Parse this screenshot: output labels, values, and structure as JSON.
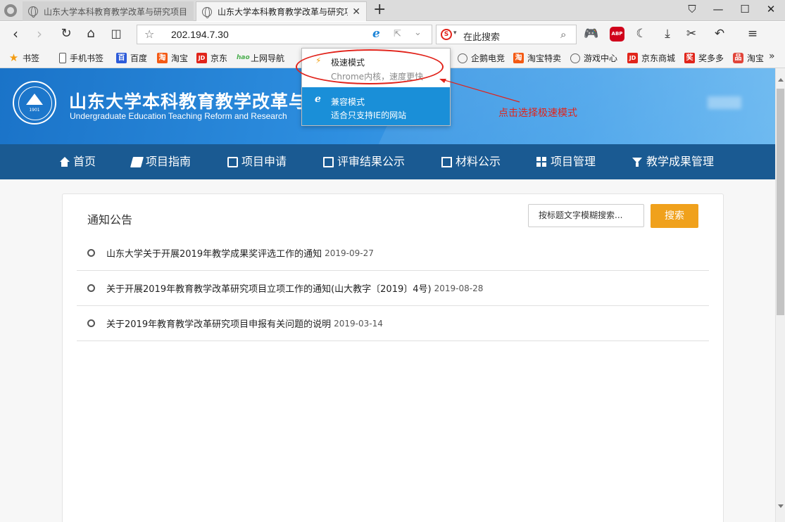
{
  "browser": {
    "tabs": [
      {
        "title": "山东大学本科教育教学改革与研究项目",
        "active": false
      },
      {
        "title": "山东大学本科教育教学改革与研究项",
        "active": true
      }
    ],
    "address": "202.194.7.30",
    "search_placeholder": "在此搜索",
    "bookmarks": [
      {
        "label": "书签",
        "icon": "star-icon"
      },
      {
        "label": "手机书签",
        "icon": "phone-icon"
      },
      {
        "label": "百度",
        "icon": "baidu-icon"
      },
      {
        "label": "淘宝",
        "icon": "taobao-icon"
      },
      {
        "label": "京东",
        "icon": "jd-icon"
      },
      {
        "label": "上网导航",
        "icon": "hao-icon"
      },
      {
        "label": "企鹅电竞",
        "icon": "globe-icon"
      },
      {
        "label": "淘宝特卖",
        "icon": "taobao-icon"
      },
      {
        "label": "游戏中心",
        "icon": "globe-icon"
      },
      {
        "label": "京东商城",
        "icon": "jd-icon"
      },
      {
        "label": "奖多多",
        "icon": "jiang-icon"
      },
      {
        "label": "淘宝",
        "icon": "ping-icon"
      }
    ],
    "icon_glyphs": {
      "jd": "JD",
      "taobao": "淘",
      "baidu": "百",
      "jiang": "奖",
      "ping": "品",
      "hao": "hao",
      "sogou": "S",
      "abp": "ABP"
    }
  },
  "mode_popup": {
    "fast": {
      "title": "极速模式",
      "desc": "Chrome内核，速度更快"
    },
    "compat": {
      "title": "兼容模式",
      "desc": "适合只支持IE的网站"
    }
  },
  "annotation": {
    "text": "点击选择极速模式",
    "color": "#e1231b"
  },
  "site": {
    "title": "山东大学本科教育教学改革与研",
    "subtitle": "Undergraduate Education Teaching Reform and Research",
    "seal_year": "1901"
  },
  "nav": [
    {
      "label": "首页",
      "icon": "home-icon"
    },
    {
      "label": "项目指南",
      "icon": "book-icon"
    },
    {
      "label": "项目申请",
      "icon": "edit-icon"
    },
    {
      "label": "评审结果公示",
      "icon": "docs-icon"
    },
    {
      "label": "材料公示",
      "icon": "file-icon"
    },
    {
      "label": "项目管理",
      "icon": "grid-icon"
    },
    {
      "label": "教学成果管理",
      "icon": "filter-icon"
    }
  ],
  "notices": {
    "heading": "通知公告",
    "search_placeholder": "按标题文字模糊搜索...",
    "search_button": "搜索",
    "items": [
      {
        "title": "山东大学关于开展2019年教学成果奖评选工作的通知",
        "date": "2019-09-27"
      },
      {
        "title": "关于开展2019年教育教学改革研究项目立项工作的通知(山大教字〔2019〕4号)",
        "date": "2019-08-28"
      },
      {
        "title": "关于2019年教育教学改革研究项目申报有关问题的说明",
        "date": "2019-03-14"
      }
    ]
  },
  "colors": {
    "banner": "#2e8fe0",
    "nav": "#1a5a92",
    "search_button": "#f0a11c",
    "popup_highlight": "#1a8fd8"
  }
}
